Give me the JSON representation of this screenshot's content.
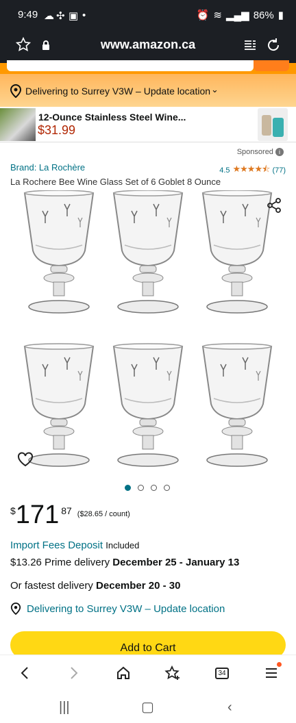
{
  "status": {
    "time": "9:49",
    "battery": "86%"
  },
  "browser": {
    "url": "www.amazon.ca"
  },
  "location_banner": {
    "text": "Delivering to Surrey V3W – Update location"
  },
  "ad": {
    "title": "12-Ounce Stainless Steel Wine...",
    "price": "$31.99"
  },
  "sponsored": "Sponsored",
  "product": {
    "brand": "Brand: La Rochère",
    "rating": "4.5",
    "reviews": "(77)",
    "title": "La Rochere Bee Wine Glass Set of 6 Goblet 8 Ounce",
    "price_symbol": "$",
    "price_whole": "171",
    "price_fraction": "87",
    "unit_price": "($28.65 / count)",
    "import_label": "Import Fees Deposit",
    "import_value": "Included",
    "prime_delivery_prefix": "$13.26 Prime delivery ",
    "prime_delivery_dates": "December 25 - January 13",
    "fastest_prefix": "Or fastest delivery ",
    "fastest_dates": "December 20 - 30",
    "location": "Delivering to Surrey V3W – Update location",
    "add_to_cart": "Add to Cart"
  },
  "gallery": {
    "dots": 4,
    "active": 0
  },
  "browser_nav": {
    "tabs_count": "34"
  },
  "colors": {
    "link": "#007185",
    "price_red": "#b12704",
    "cart": "#ffd814",
    "star": "#de7921"
  }
}
